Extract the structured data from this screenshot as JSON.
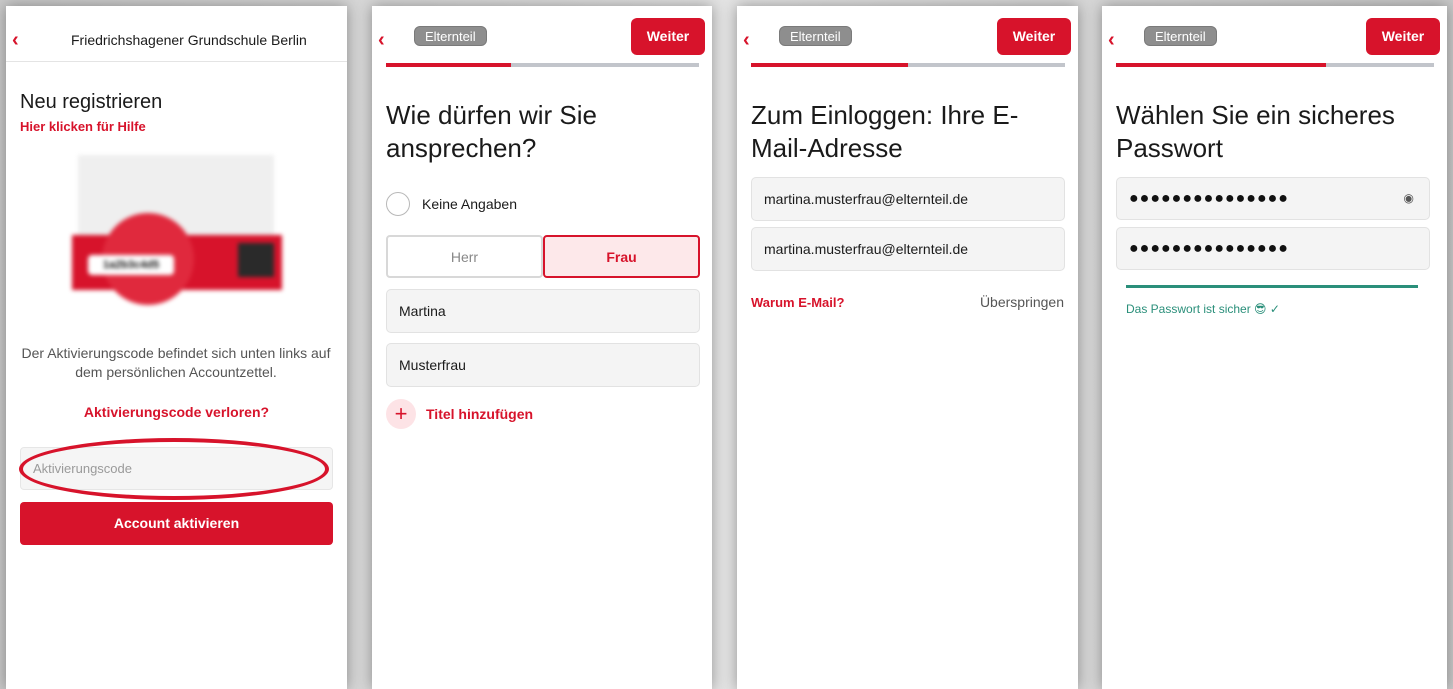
{
  "screen1": {
    "back_icon": "chevron-left",
    "school": "Friedrichshagener Grundschule Berlin",
    "title": "Neu registrieren",
    "help_link": "Hier klicken für Hilfe",
    "card_code": "1a2b3c4d5",
    "info": "Der Aktivierungscode befindet sich unten links auf dem persönlichen Accountzettel.",
    "lost_link": "Aktivierungscode verloren?",
    "code_placeholder": "Aktivierungscode",
    "activate_button": "Account aktivieren"
  },
  "screen2": {
    "role_pill": "Elternteil",
    "next_button": "Weiter",
    "progress": 0.4,
    "title": "Wie dürfen wir Sie ansprechen?",
    "no_info": "Keine Angaben",
    "salutation_options": [
      "Herr",
      "Frau"
    ],
    "salutation_selected": "Frau",
    "first_name": "Martina",
    "last_name": "Musterfrau",
    "add_title": "Titel hinzufügen"
  },
  "screen3": {
    "role_pill": "Elternteil",
    "next_button": "Weiter",
    "progress": 0.5,
    "title": "Zum Einloggen: Ihre E-Mail-Adresse",
    "email": "martina.musterfrau@elternteil.de",
    "email_confirm": "martina.musterfrau@elternteil.de",
    "why_email": "Warum E-Mail?",
    "skip": "Überspringen"
  },
  "screen4": {
    "role_pill": "Elternteil",
    "next_button": "Weiter",
    "progress": 0.66,
    "title": "Wählen Sie ein sicheres Passwort",
    "password_mask": "●●●●●●●●●●●●●●●",
    "password_confirm_mask": "●●●●●●●●●●●●●●●",
    "eye_icon": "eye",
    "strength_text": "Das Passwort ist sicher 😎 ✓"
  },
  "colors": {
    "accent": "#d7132b",
    "success": "#2a8f7a"
  }
}
